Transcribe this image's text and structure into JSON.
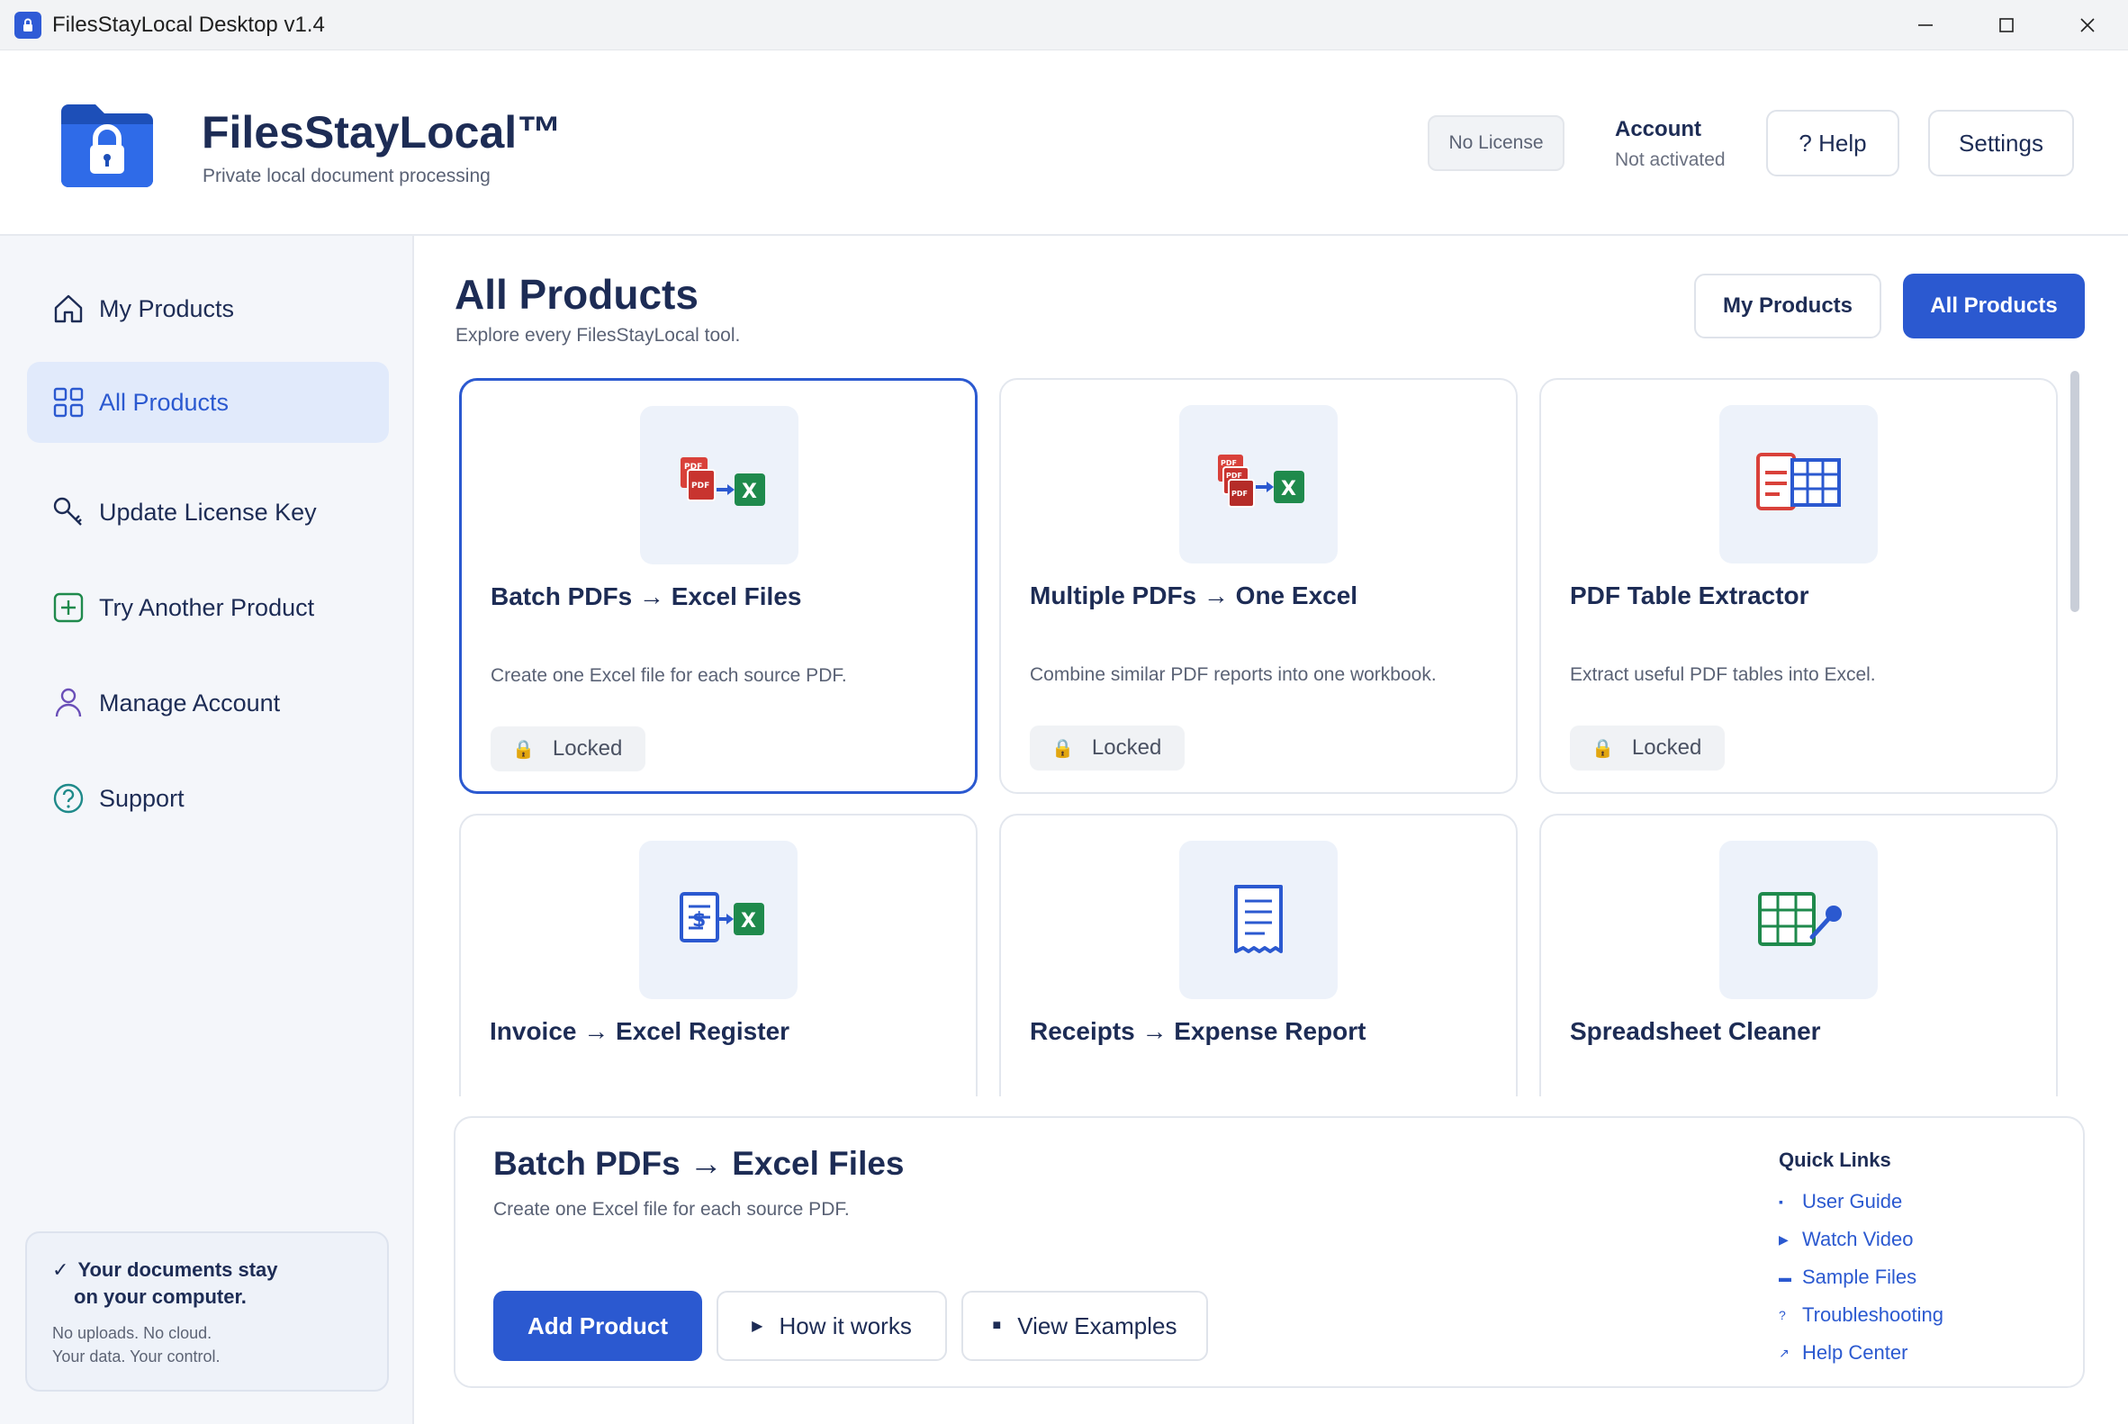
{
  "window": {
    "title": "FilesStayLocal Desktop v1.4"
  },
  "header": {
    "brand_name": "FilesStayLocal™",
    "brand_tagline": "Private local document processing",
    "license_badge": "No License",
    "account_label": "Account",
    "account_status": "Not activated",
    "help_label": "? Help",
    "settings_label": "Settings"
  },
  "sidebar": {
    "items": [
      {
        "label": "My Products",
        "icon": "home-icon",
        "active": false
      },
      {
        "label": "All Products",
        "icon": "grid-icon",
        "active": true
      },
      {
        "label": "Update License Key",
        "icon": "key-icon",
        "active": false
      },
      {
        "label": "Try Another Product",
        "icon": "plus-square-icon",
        "active": false
      },
      {
        "label": "Manage Account",
        "icon": "user-icon",
        "active": false
      },
      {
        "label": "Support",
        "icon": "question-circle-icon",
        "active": false
      }
    ],
    "privacy": {
      "check": "✓",
      "title_line1": "Your documents stay",
      "title_line2": "on your computer.",
      "sub_line1": "No uploads. No cloud.",
      "sub_line2": "Your data. Your control."
    }
  },
  "main": {
    "title": "All Products",
    "subtitle": "Explore every FilesStayLocal tool.",
    "toggle": {
      "my_products": "My Products",
      "all_products": "All Products",
      "selected": "All Products"
    },
    "products": [
      {
        "title": "Batch PDFs → Excel Files",
        "desc": "Create one Excel file for each source PDF.",
        "status": "Locked",
        "icon": "pdf-to-excel-icon",
        "selected": true
      },
      {
        "title": "Multiple PDFs → One Excel",
        "desc": "Combine similar PDF reports into one workbook.",
        "status": "Locked",
        "icon": "multi-pdf-to-excel-icon",
        "selected": false
      },
      {
        "title": "PDF Table Extractor",
        "desc": "Extract useful PDF tables into Excel.",
        "status": "Locked",
        "icon": "table-extract-icon",
        "selected": false
      },
      {
        "title": "Invoice → Excel Register",
        "desc": "",
        "status": "",
        "icon": "invoice-to-excel-icon",
        "selected": false
      },
      {
        "title": "Receipts → Expense Report",
        "desc": "",
        "status": "",
        "icon": "receipt-icon",
        "selected": false
      },
      {
        "title": "Spreadsheet Cleaner",
        "desc": "",
        "status": "",
        "icon": "spreadsheet-clean-icon",
        "selected": false
      }
    ]
  },
  "detail": {
    "title": "Batch PDFs → Excel Files",
    "desc": "Create one Excel file for each source PDF.",
    "add_label": "Add Product",
    "how_label": "How it works",
    "examples_label": "View Examples",
    "quick_links_title": "Quick Links",
    "quick_links": [
      {
        "glyph": "▪",
        "label": "User Guide"
      },
      {
        "glyph": "▶",
        "label": "Watch Video"
      },
      {
        "glyph": "▬",
        "label": "Sample Files"
      },
      {
        "glyph": "?",
        "label": "Troubleshooting"
      },
      {
        "glyph": "↗",
        "label": "Help Center"
      }
    ]
  },
  "colors": {
    "accent": "#2b59d0",
    "excel_green": "#1f8a4c",
    "pdf_red": "#d9413a"
  }
}
